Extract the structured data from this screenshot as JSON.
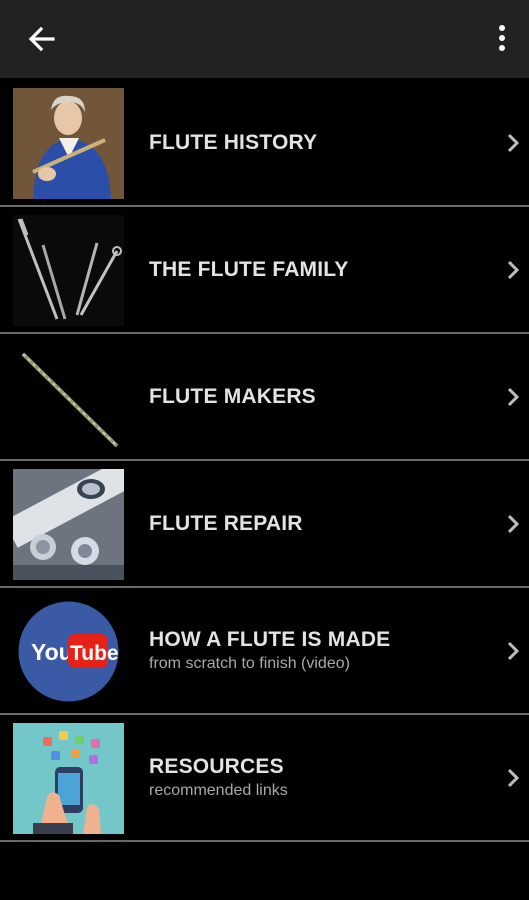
{
  "appbar": {
    "back_icon": "arrow-back-icon",
    "menu_icon": "more-vert-icon"
  },
  "items": [
    {
      "title": "FLUTE HISTORY",
      "subtitle": "",
      "thumb": "portrait-image"
    },
    {
      "title": "THE FLUTE FAMILY",
      "subtitle": "",
      "thumb": "flutes-image"
    },
    {
      "title": "FLUTE MAKERS",
      "subtitle": "",
      "thumb": "flute-image"
    },
    {
      "title": "FLUTE REPAIR",
      "subtitle": "",
      "thumb": "flute-keys-image"
    },
    {
      "title": "HOW A FLUTE IS MADE",
      "subtitle": "from scratch to finish (video)",
      "thumb": "youtube-logo"
    },
    {
      "title": "RESOURCES",
      "subtitle": "recommended links",
      "thumb": "apps-phone-illustration"
    }
  ],
  "youtube": {
    "you": "You",
    "tube": "Tube"
  },
  "colors": {
    "appbar": "#222222",
    "divider": "#6a6a6a",
    "youtube_red": "#e62117",
    "youtube_circle": "#3a5aa6",
    "resources_bg": "#74c7c9"
  }
}
